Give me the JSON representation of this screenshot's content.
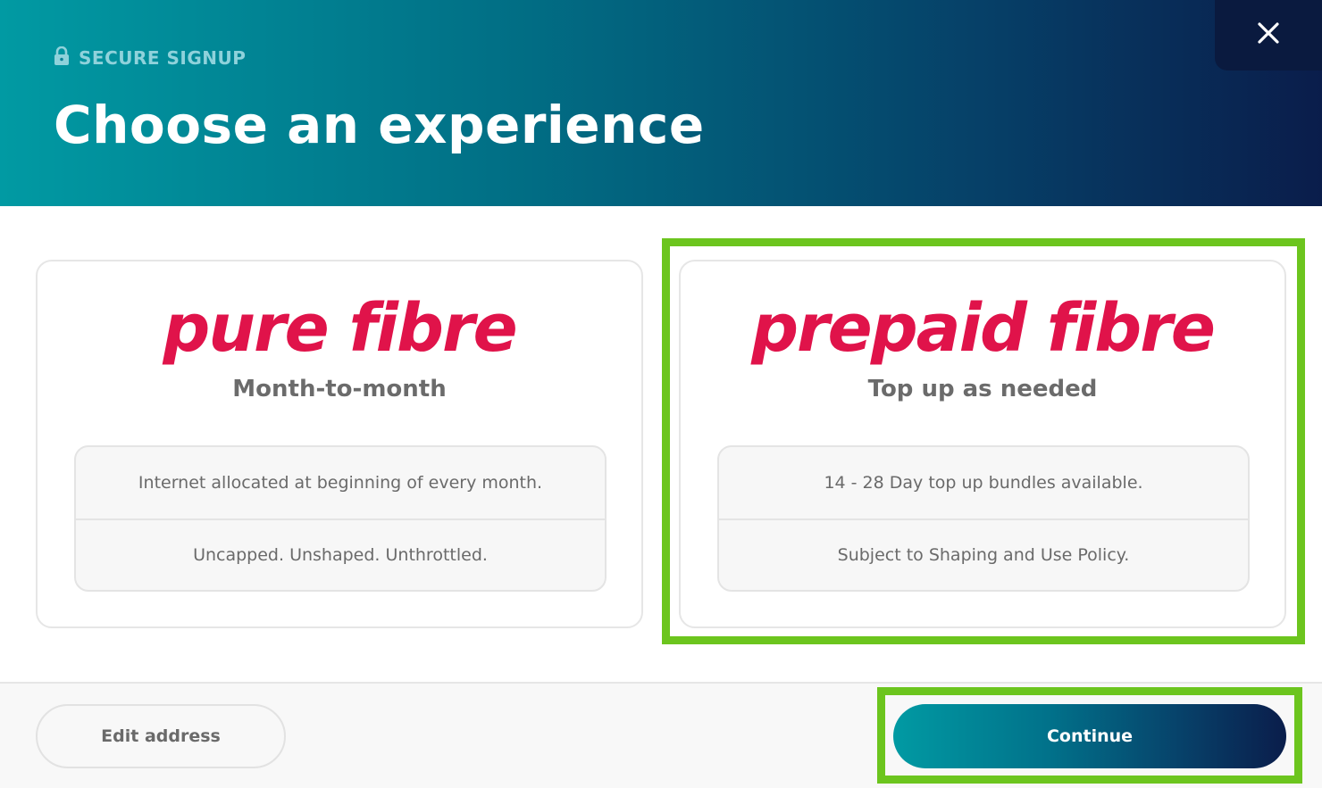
{
  "header": {
    "secure_label": "SECURE SIGNUP",
    "title": "Choose an experience",
    "close_icon": "close-icon",
    "lock_icon": "lock-icon"
  },
  "plans": [
    {
      "logo": "pure fibre",
      "subtitle": "Month-to-month",
      "features": [
        "Internet allocated at beginning of every month.",
        "Uncapped. Unshaped. Unthrottled."
      ],
      "selected": false
    },
    {
      "logo": "prepaid fibre",
      "subtitle": "Top up as needed",
      "features": [
        "14 - 28 Day top up bundles available.",
        "Subject to Shaping and Use Policy."
      ],
      "selected": true
    }
  ],
  "footer": {
    "edit_label": "Edit address",
    "continue_label": "Continue"
  },
  "colors": {
    "brand_pink": "#e0134a",
    "gradient_start": "#019aa3",
    "gradient_end": "#0a1d4b",
    "highlight_green": "#6cc51e"
  }
}
